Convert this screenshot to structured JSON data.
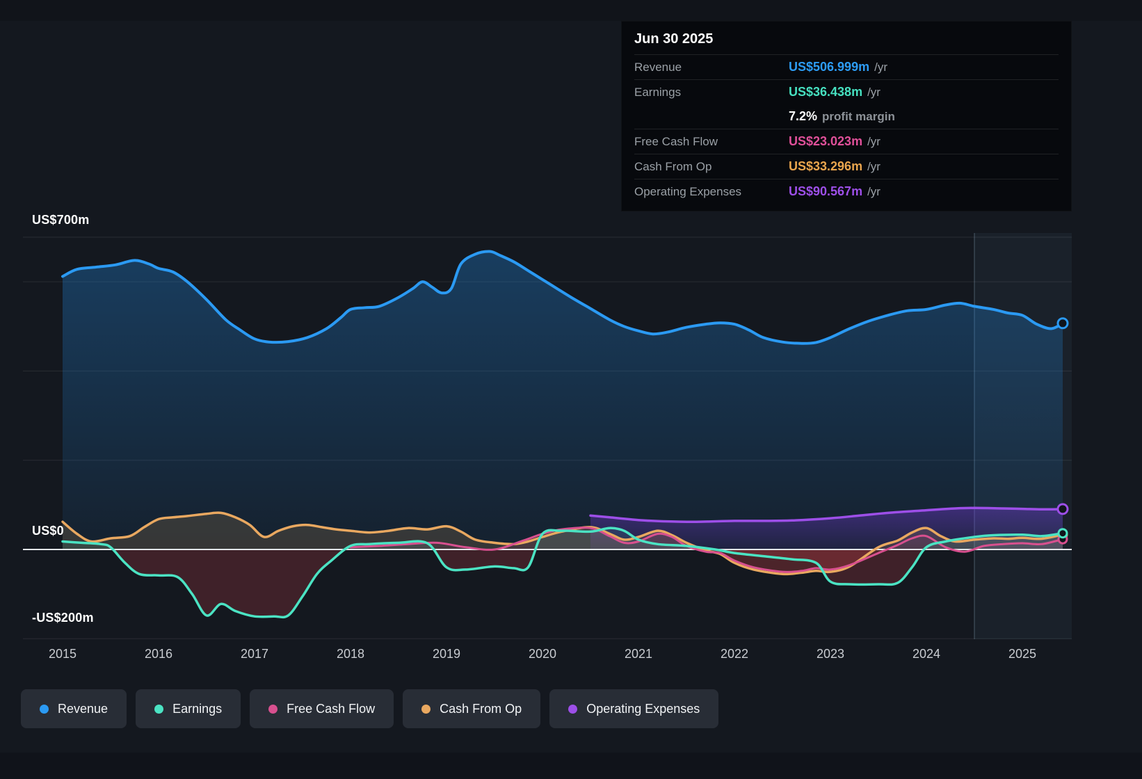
{
  "tooltip": {
    "date": "Jun 30 2025",
    "rows": [
      {
        "label": "Revenue",
        "value": "US$506.999m",
        "suffix": "/yr",
        "color": "#2d9cf4"
      },
      {
        "label": "Earnings",
        "value": "US$36.438m",
        "suffix": "/yr",
        "color": "#46e0c0"
      },
      {
        "label": "",
        "value": "7.2%",
        "suffix": "profit margin",
        "color": "#ffffff"
      },
      {
        "label": "Free Cash Flow",
        "value": "US$23.023m",
        "suffix": "/yr",
        "color": "#e0509a"
      },
      {
        "label": "Cash From Op",
        "value": "US$33.296m",
        "suffix": "/yr",
        "color": "#e9a54e"
      },
      {
        "label": "Operating Expenses",
        "value": "US$90.567m",
        "suffix": "/yr",
        "color": "#9d4fe8"
      }
    ]
  },
  "legend": {
    "items": [
      {
        "label": "Revenue",
        "color": "#2b9af3"
      },
      {
        "label": "Earnings",
        "color": "#4be3c3"
      },
      {
        "label": "Free Cash Flow",
        "color": "#d8508f"
      },
      {
        "label": "Cash From Op",
        "color": "#e9a860"
      },
      {
        "label": "Operating Expenses",
        "color": "#9d4fe8"
      }
    ]
  },
  "chart_data": {
    "type": "line",
    "x_base": 2015,
    "x_ticks": [
      "2015",
      "2016",
      "2017",
      "2018",
      "2019",
      "2020",
      "2021",
      "2022",
      "2023",
      "2024",
      "2025"
    ],
    "x_tick_values": [
      2015,
      2016,
      2017,
      2018,
      2019,
      2020,
      2021,
      2022,
      2023,
      2024,
      2025
    ],
    "ylim": [
      -200,
      700
    ],
    "y_labels": [
      {
        "text": "US$700m",
        "value": 700
      },
      {
        "text": "US$0",
        "value": 0
      },
      {
        "text": "-US$200m",
        "value": -200
      }
    ],
    "gridline_values": [
      700,
      600,
      400,
      200,
      -200
    ],
    "divider_x": 2024.5,
    "series": [
      {
        "name": "Revenue",
        "color": "#2b9af3",
        "width": 4,
        "fill": "blue-gradient",
        "dot_r": 7,
        "points": [
          [
            2015.0,
            612
          ],
          [
            2015.15,
            628
          ],
          [
            2015.35,
            633
          ],
          [
            2015.55,
            638
          ],
          [
            2015.75,
            648
          ],
          [
            2015.9,
            640
          ],
          [
            2016.0,
            630
          ],
          [
            2016.15,
            622
          ],
          [
            2016.3,
            600
          ],
          [
            2016.5,
            560
          ],
          [
            2016.7,
            515
          ],
          [
            2016.85,
            492
          ],
          [
            2017.0,
            472
          ],
          [
            2017.15,
            465
          ],
          [
            2017.35,
            466
          ],
          [
            2017.55,
            475
          ],
          [
            2017.75,
            495
          ],
          [
            2017.9,
            520
          ],
          [
            2018.0,
            538
          ],
          [
            2018.15,
            542
          ],
          [
            2018.3,
            545
          ],
          [
            2018.5,
            565
          ],
          [
            2018.65,
            585
          ],
          [
            2018.75,
            600
          ],
          [
            2018.85,
            588
          ],
          [
            2018.95,
            575
          ],
          [
            2019.05,
            585
          ],
          [
            2019.15,
            640
          ],
          [
            2019.3,
            662
          ],
          [
            2019.45,
            668
          ],
          [
            2019.55,
            660
          ],
          [
            2019.7,
            645
          ],
          [
            2019.85,
            625
          ],
          [
            2020.0,
            605
          ],
          [
            2020.15,
            585
          ],
          [
            2020.3,
            565
          ],
          [
            2020.5,
            540
          ],
          [
            2020.7,
            515
          ],
          [
            2020.85,
            500
          ],
          [
            2021.0,
            490
          ],
          [
            2021.15,
            483
          ],
          [
            2021.3,
            487
          ],
          [
            2021.5,
            498
          ],
          [
            2021.7,
            505
          ],
          [
            2021.85,
            508
          ],
          [
            2022.0,
            505
          ],
          [
            2022.15,
            492
          ],
          [
            2022.3,
            475
          ],
          [
            2022.5,
            465
          ],
          [
            2022.7,
            462
          ],
          [
            2022.85,
            464
          ],
          [
            2023.0,
            475
          ],
          [
            2023.2,
            495
          ],
          [
            2023.4,
            512
          ],
          [
            2023.6,
            525
          ],
          [
            2023.8,
            535
          ],
          [
            2024.0,
            538
          ],
          [
            2024.2,
            548
          ],
          [
            2024.35,
            552
          ],
          [
            2024.5,
            545
          ],
          [
            2024.7,
            538
          ],
          [
            2024.85,
            530
          ],
          [
            2025.0,
            525
          ],
          [
            2025.15,
            505
          ],
          [
            2025.3,
            495
          ],
          [
            2025.42,
            507
          ]
        ]
      },
      {
        "name": "Operating Expenses",
        "color": "#9d4fe8",
        "width": 3.5,
        "fill": "purple-gradient",
        "dot_r": 7,
        "points": [
          [
            2020.5,
            76
          ],
          [
            2020.7,
            72
          ],
          [
            2021.0,
            66
          ],
          [
            2021.3,
            63
          ],
          [
            2021.6,
            62
          ],
          [
            2022.0,
            64
          ],
          [
            2022.3,
            64
          ],
          [
            2022.6,
            65
          ],
          [
            2023.0,
            70
          ],
          [
            2023.3,
            76
          ],
          [
            2023.6,
            82
          ],
          [
            2024.0,
            88
          ],
          [
            2024.3,
            92
          ],
          [
            2024.5,
            93
          ],
          [
            2024.8,
            92
          ],
          [
            2025.0,
            91
          ],
          [
            2025.2,
            90
          ],
          [
            2025.42,
            90.6
          ]
        ]
      },
      {
        "name": "Cash From Op",
        "color": "#e9a860",
        "width": 3.5,
        "fill": "sign",
        "pos_fill": "rgba(233,168,96,0.16)",
        "neg_fill": "rgba(190,60,70,0.20)",
        "dot_r": 6,
        "points": [
          [
            2015.0,
            62
          ],
          [
            2015.15,
            35
          ],
          [
            2015.3,
            18
          ],
          [
            2015.5,
            25
          ],
          [
            2015.7,
            30
          ],
          [
            2015.85,
            50
          ],
          [
            2016.0,
            68
          ],
          [
            2016.15,
            72
          ],
          [
            2016.3,
            75
          ],
          [
            2016.5,
            80
          ],
          [
            2016.65,
            82
          ],
          [
            2016.8,
            72
          ],
          [
            2016.95,
            55
          ],
          [
            2017.1,
            28
          ],
          [
            2017.25,
            42
          ],
          [
            2017.4,
            52
          ],
          [
            2017.55,
            55
          ],
          [
            2017.7,
            50
          ],
          [
            2017.85,
            45
          ],
          [
            2018.0,
            42
          ],
          [
            2018.2,
            38
          ],
          [
            2018.4,
            42
          ],
          [
            2018.6,
            48
          ],
          [
            2018.8,
            45
          ],
          [
            2019.0,
            52
          ],
          [
            2019.15,
            40
          ],
          [
            2019.3,
            22
          ],
          [
            2019.5,
            15
          ],
          [
            2019.7,
            12
          ],
          [
            2019.85,
            18
          ],
          [
            2020.0,
            28
          ],
          [
            2020.2,
            40
          ],
          [
            2020.5,
            50
          ],
          [
            2020.7,
            35
          ],
          [
            2020.85,
            22
          ],
          [
            2021.0,
            28
          ],
          [
            2021.2,
            42
          ],
          [
            2021.35,
            32
          ],
          [
            2021.5,
            15
          ],
          [
            2021.7,
            -2
          ],
          [
            2021.85,
            -10
          ],
          [
            2022.0,
            -30
          ],
          [
            2022.2,
            -45
          ],
          [
            2022.5,
            -55
          ],
          [
            2022.7,
            -52
          ],
          [
            2022.85,
            -48
          ],
          [
            2023.0,
            -50
          ],
          [
            2023.2,
            -38
          ],
          [
            2023.5,
            5
          ],
          [
            2023.7,
            20
          ],
          [
            2023.85,
            38
          ],
          [
            2024.0,
            48
          ],
          [
            2024.15,
            30
          ],
          [
            2024.3,
            18
          ],
          [
            2024.5,
            22
          ],
          [
            2024.7,
            25
          ],
          [
            2024.85,
            24
          ],
          [
            2025.0,
            26
          ],
          [
            2025.2,
            24
          ],
          [
            2025.42,
            33.3
          ]
        ]
      },
      {
        "name": "Free Cash Flow",
        "color": "#d8508f",
        "width": 3,
        "fill": "sign",
        "pos_fill": "rgba(216,80,143,0.10)",
        "neg_fill": "rgba(190,60,70,0.16)",
        "dot_r": 6,
        "points": [
          [
            2018.0,
            5
          ],
          [
            2018.3,
            8
          ],
          [
            2018.6,
            12
          ],
          [
            2018.9,
            15
          ],
          [
            2019.2,
            5
          ],
          [
            2019.5,
            0
          ],
          [
            2019.8,
            20
          ],
          [
            2020.0,
            35
          ],
          [
            2020.2,
            45
          ],
          [
            2020.5,
            48
          ],
          [
            2020.7,
            30
          ],
          [
            2020.85,
            15
          ],
          [
            2021.0,
            18
          ],
          [
            2021.2,
            35
          ],
          [
            2021.35,
            28
          ],
          [
            2021.5,
            8
          ],
          [
            2021.7,
            -5
          ],
          [
            2021.85,
            -8
          ],
          [
            2022.0,
            -25
          ],
          [
            2022.2,
            -40
          ],
          [
            2022.5,
            -50
          ],
          [
            2022.7,
            -48
          ],
          [
            2022.85,
            -42
          ],
          [
            2023.0,
            -45
          ],
          [
            2023.2,
            -35
          ],
          [
            2023.5,
            -8
          ],
          [
            2023.7,
            10
          ],
          [
            2023.85,
            25
          ],
          [
            2024.0,
            30
          ],
          [
            2024.2,
            5
          ],
          [
            2024.4,
            -5
          ],
          [
            2024.6,
            8
          ],
          [
            2024.8,
            12
          ],
          [
            2025.0,
            14
          ],
          [
            2025.2,
            12
          ],
          [
            2025.42,
            23
          ]
        ]
      },
      {
        "name": "Earnings",
        "color": "#4be3c3",
        "width": 3.5,
        "fill": "sign",
        "pos_fill": "rgba(75,227,195,0.10)",
        "neg_fill": "rgba(190,60,70,0.26)",
        "dot_r": 6,
        "points": [
          [
            2015.0,
            18
          ],
          [
            2015.2,
            15
          ],
          [
            2015.4,
            12
          ],
          [
            2015.5,
            5
          ],
          [
            2015.65,
            -30
          ],
          [
            2015.8,
            -55
          ],
          [
            2016.0,
            -58
          ],
          [
            2016.2,
            -62
          ],
          [
            2016.35,
            -100
          ],
          [
            2016.5,
            -148
          ],
          [
            2016.65,
            -122
          ],
          [
            2016.8,
            -138
          ],
          [
            2017.0,
            -150
          ],
          [
            2017.2,
            -150
          ],
          [
            2017.35,
            -148
          ],
          [
            2017.5,
            -105
          ],
          [
            2017.65,
            -55
          ],
          [
            2017.8,
            -25
          ],
          [
            2018.0,
            8
          ],
          [
            2018.2,
            12
          ],
          [
            2018.5,
            15
          ],
          [
            2018.8,
            14
          ],
          [
            2019.0,
            -40
          ],
          [
            2019.2,
            -45
          ],
          [
            2019.5,
            -38
          ],
          [
            2019.7,
            -42
          ],
          [
            2019.85,
            -40
          ],
          [
            2020.0,
            35
          ],
          [
            2020.2,
            42
          ],
          [
            2020.5,
            40
          ],
          [
            2020.7,
            48
          ],
          [
            2020.85,
            42
          ],
          [
            2021.0,
            22
          ],
          [
            2021.2,
            12
          ],
          [
            2021.5,
            8
          ],
          [
            2021.8,
            0
          ],
          [
            2022.0,
            -8
          ],
          [
            2022.3,
            -15
          ],
          [
            2022.6,
            -22
          ],
          [
            2022.85,
            -30
          ],
          [
            2023.0,
            -72
          ],
          [
            2023.2,
            -78
          ],
          [
            2023.5,
            -78
          ],
          [
            2023.7,
            -75
          ],
          [
            2023.85,
            -40
          ],
          [
            2024.0,
            5
          ],
          [
            2024.2,
            18
          ],
          [
            2024.5,
            28
          ],
          [
            2024.7,
            32
          ],
          [
            2025.0,
            33
          ],
          [
            2025.2,
            30
          ],
          [
            2025.42,
            36.4
          ]
        ]
      }
    ]
  }
}
